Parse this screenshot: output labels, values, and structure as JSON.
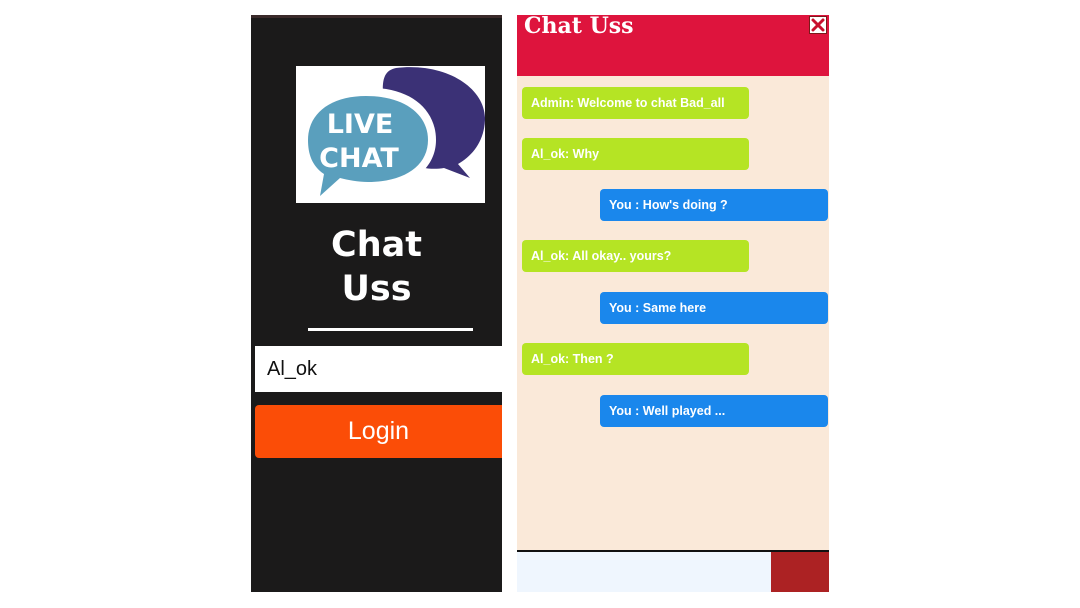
{
  "login_screen": {
    "logo": {
      "line1": "LIVE",
      "line2": "CHAT",
      "colors": {
        "front_bubble": "#5a9fbd",
        "back_bubble": "#3b3176"
      }
    },
    "app_name_line1": "Chat",
    "app_name_line2": "Uss",
    "username_value": "Al_ok",
    "login_label": "Login",
    "colors": {
      "background": "#1b1a1a",
      "login_button": "#fb4d07"
    }
  },
  "chat_screen": {
    "title": "Chat Uss",
    "close_icon": "close-icon",
    "messages": [
      {
        "direction": "incoming",
        "text": "Admin: Welcome to chat Bad_all"
      },
      {
        "direction": "incoming",
        "text": "Al_ok: Why"
      },
      {
        "direction": "outgoing",
        "text": "You : How's doing ?"
      },
      {
        "direction": "incoming",
        "text": "Al_ok: All okay.. yours?"
      },
      {
        "direction": "outgoing",
        "text": "You : Same here"
      },
      {
        "direction": "incoming",
        "text": "Al_ok: Then ?"
      },
      {
        "direction": "outgoing",
        "text": "You : Well played ..."
      }
    ],
    "message_input_value": "",
    "colors": {
      "header": "#de143d",
      "background": "#fae9d9",
      "incoming_bubble": "#b5e424",
      "outgoing_bubble": "#1a87ec",
      "send_button": "#ac2223"
    }
  }
}
